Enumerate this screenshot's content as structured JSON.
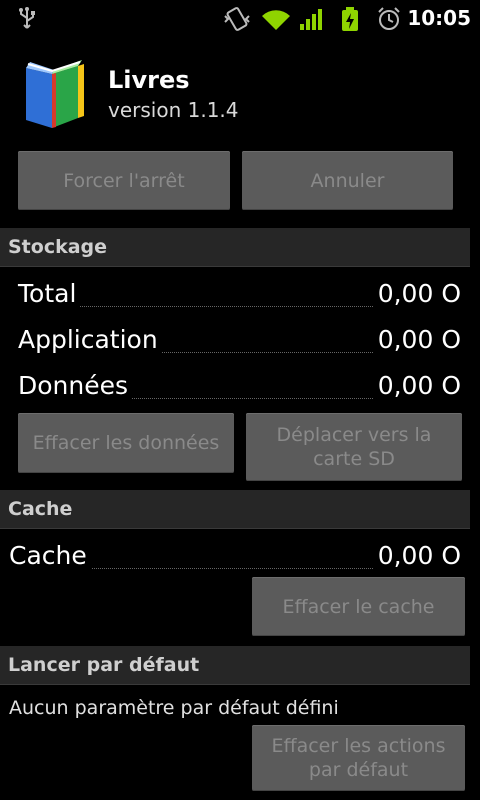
{
  "status_bar": {
    "time": "10:05",
    "icons": [
      "usb-icon",
      "vibrate-icon",
      "wifi-icon",
      "signal-icon",
      "battery-charging-icon",
      "alarm-icon"
    ]
  },
  "app": {
    "name": "Livres",
    "version": "version 1.1.4",
    "icon": "books-app-icon"
  },
  "actions": {
    "force_stop": "Forcer l'arrêt",
    "uninstall": "Annuler"
  },
  "storage": {
    "title": "Stockage",
    "rows": [
      {
        "label": "Total",
        "value": "0,00 O"
      },
      {
        "label": "Application",
        "value": "0,00 O"
      },
      {
        "label": "Données",
        "value": "0,00 O"
      }
    ],
    "clear_data": "Effacer les données",
    "move_sd_line1": "Déplacer vers la",
    "move_sd_line2": "carte SD"
  },
  "cache": {
    "title": "Cache",
    "label": "Cache",
    "value": "0,00 O",
    "clear_cache": "Effacer le cache"
  },
  "defaults": {
    "title": "Lancer par défaut",
    "text": "Aucun paramètre par défaut défini",
    "clear_line1": "Effacer les actions",
    "clear_line2": "par défaut"
  },
  "colors": {
    "background": "#000000",
    "button": "#5b5b5b",
    "button_text": "#8a8a8a",
    "section_header": "#262626",
    "status_green": "#8fd400"
  }
}
